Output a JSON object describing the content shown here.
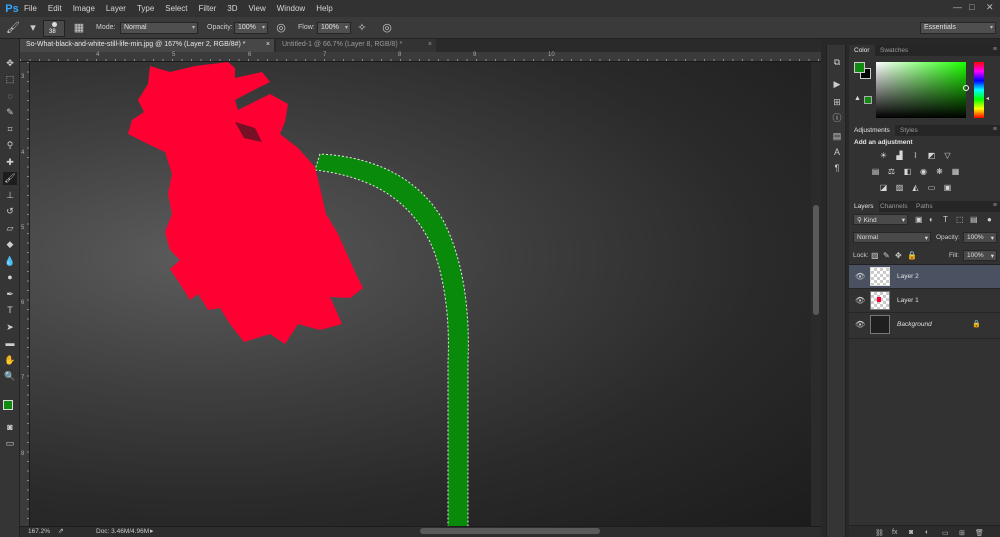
{
  "app": {
    "logo": "Ps",
    "workspace": "Essentials"
  },
  "menu": [
    "File",
    "Edit",
    "Image",
    "Layer",
    "Type",
    "Select",
    "Filter",
    "3D",
    "View",
    "Window",
    "Help"
  ],
  "window_controls": {
    "minimize": "—",
    "maximize": "□",
    "close": "✕"
  },
  "options": {
    "brush_size": "38",
    "mode_label": "Mode:",
    "mode_value": "Normal",
    "opacity_label": "Opacity:",
    "opacity_value": "100%",
    "flow_label": "Flow:",
    "flow_value": "100%"
  },
  "tabs": [
    {
      "title": "So-What-black-and-white-still-life-min.jpg @ 167% (Layer 2, RGB/8#) *",
      "close": "×"
    },
    {
      "title": "Untitled-1 @ 66.7% (Layer 8, RGB/8) *",
      "close": "×"
    }
  ],
  "ruler": {
    "h_labels": [
      "4",
      "5",
      "6",
      "7",
      "8",
      "9",
      "10"
    ],
    "v_labels": [
      "3",
      "4",
      "5",
      "6",
      "7",
      "8"
    ]
  },
  "status": {
    "zoom": "167.2%",
    "doc": "Doc: 3.46M/4.96M"
  },
  "colors": {
    "foreground": "#118a11",
    "background": "#000000",
    "flower": "#ff0033",
    "stem": "#0a8a0a",
    "accent": "#4a5262"
  },
  "panels": {
    "color_tabs": [
      "Color",
      "Swatches"
    ],
    "adjust_tabs": [
      "Adjustments",
      "Styles"
    ],
    "adjust_title": "Add an adjustment",
    "layers_tabs": [
      "Layers",
      "Channels",
      "Paths"
    ],
    "kind_label": "Kind",
    "blend_value": "Normal",
    "opacity_label": "Opacity:",
    "opacity_value": "100%",
    "lock_label": "Lock:",
    "fill_label": "Fill:",
    "fill_value": "100%",
    "layers": [
      {
        "name": "Layer 2",
        "selected": true,
        "locked": false
      },
      {
        "name": "Layer 1",
        "selected": false,
        "locked": false
      },
      {
        "name": "Background",
        "selected": false,
        "locked": true
      }
    ],
    "bottom_icons": [
      "link-icon",
      "fx-icon",
      "mask-icon",
      "adjustment-icon",
      "folder-icon",
      "new-layer-icon",
      "trash-icon"
    ]
  }
}
